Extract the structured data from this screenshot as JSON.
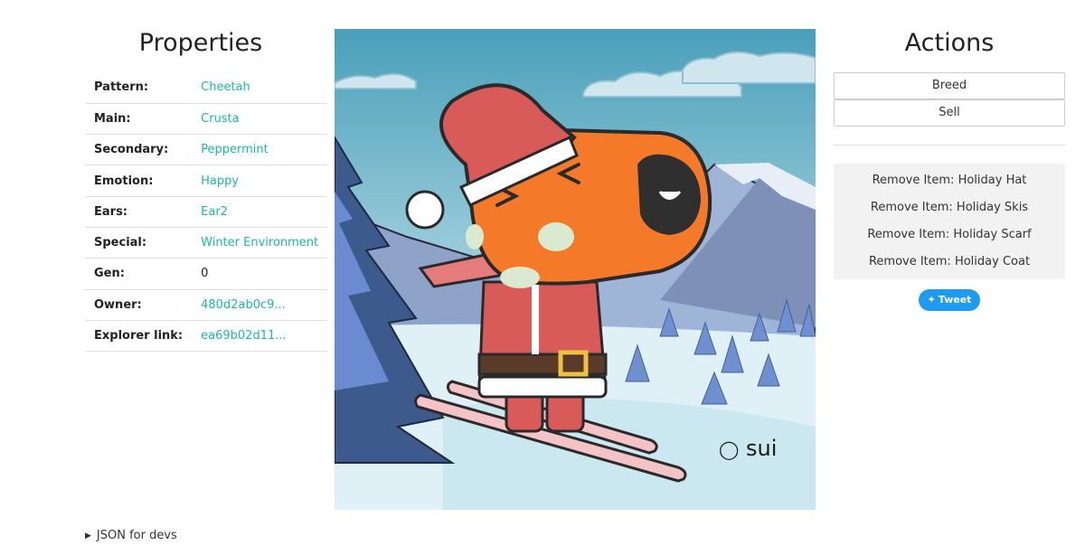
{
  "properties": {
    "title": "Properties",
    "rows": [
      {
        "key": "Pattern:",
        "value": "Cheetah"
      },
      {
        "key": "Main:",
        "value": "Crusta"
      },
      {
        "key": "Secondary:",
        "value": "Peppermint"
      },
      {
        "key": "Emotion:",
        "value": "Happy"
      },
      {
        "key": "Ears:",
        "value": "Ear2"
      },
      {
        "key": "Special:",
        "value": "Winter Environment"
      },
      {
        "key": "Gen:",
        "value": "0"
      },
      {
        "key": "Owner:",
        "value": "480d2ab0c9..."
      },
      {
        "key": "Explorer link:",
        "value": "ea69b02d11..."
      }
    ]
  },
  "hero": {
    "watermark": "sui"
  },
  "actions": {
    "title": "Actions",
    "breed_label": "Breed",
    "sell_label": "Sell",
    "remove_items": [
      "Remove Item: Holiday Hat",
      "Remove Item: Holiday Skis",
      "Remove Item: Holiday Scarf",
      "Remove Item: Holiday Coat"
    ],
    "tweet_label": "Tweet"
  },
  "footer": {
    "json_toggle": "JSON for devs"
  },
  "colors": {
    "link": "#1abc9c",
    "tweet": "#1d9bf0",
    "capy_body": "#f47a2a",
    "santa_red": "#d95b59"
  }
}
